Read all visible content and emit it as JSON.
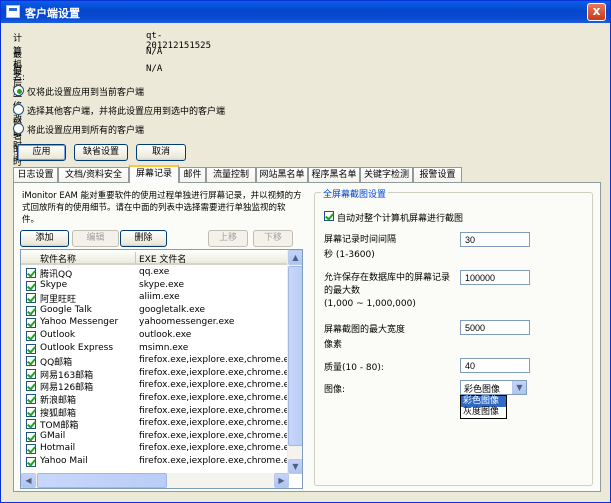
{
  "window": {
    "title": "客户端设置",
    "close_glyph": "x"
  },
  "info": {
    "computer_name_label": "计算机名:",
    "computer_name_value": "qt-201212151525",
    "last_modified_label": "最后一次修改的时间:",
    "last_modified_value": "N/A",
    "last_deployed_label": "最后一次部署的时间:",
    "last_deployed_value": "N/A"
  },
  "apply_scope": {
    "options": [
      {
        "label": "仅将此设置应用到当前客户端",
        "selected": true
      },
      {
        "label": "选择其他客户端，并将此设置应用到选中的客户端",
        "selected": false
      },
      {
        "label": "将此设置应用到所有的客户端",
        "selected": false
      }
    ]
  },
  "actions": {
    "apply": "应用",
    "default": "缺省设置",
    "cancel": "取消"
  },
  "tabs": [
    {
      "label": "日志设置",
      "active": false
    },
    {
      "label": "文档/资料安全",
      "active": false
    },
    {
      "label": "屏幕记录",
      "active": true
    },
    {
      "label": "邮件",
      "active": false
    },
    {
      "label": "流量控制",
      "active": false
    },
    {
      "label": "网站黑名单",
      "active": false
    },
    {
      "label": "程序黑名单",
      "active": false
    },
    {
      "label": "关键字检测",
      "active": false
    },
    {
      "label": "报警设置",
      "active": false
    }
  ],
  "screen_record": {
    "description": "iMonitor EAM 能对重要软件的使用过程单独进行屏幕记录，并以视频的方式回放所有的使用细节。请在中面的列表中选择需要进行单独监视的软件。",
    "buttons": {
      "add": "添加",
      "edit": "编辑",
      "delete": "删除",
      "up": "上移",
      "down": "下移"
    },
    "columns": {
      "name": "软件名称",
      "exe": "EXE 文件名"
    },
    "rows": [
      {
        "name": "腾讯QQ",
        "exe": "qq.exe",
        "checked": true
      },
      {
        "name": "Skype",
        "exe": "skype.exe",
        "checked": true
      },
      {
        "name": "阿里旺旺",
        "exe": "aliim.exe",
        "checked": true
      },
      {
        "name": "Google Talk",
        "exe": "googletalk.exe",
        "checked": true
      },
      {
        "name": "Yahoo Messenger",
        "exe": "yahoomessenger.exe",
        "checked": true
      },
      {
        "name": "Outlook",
        "exe": "outlook.exe",
        "checked": true
      },
      {
        "name": "Outlook Express",
        "exe": "msimn.exe",
        "checked": true
      },
      {
        "name": "QQ邮箱",
        "exe": "firefox.exe,iexplore.exe,chrome.exe,o...",
        "checked": true
      },
      {
        "name": "网易163邮箱",
        "exe": "firefox.exe,iexplore.exe,chrome.exe,o...",
        "checked": true
      },
      {
        "name": "网易126邮箱",
        "exe": "firefox.exe,iexplore.exe,chrome.exe,o...",
        "checked": true
      },
      {
        "name": "新浪邮箱",
        "exe": "firefox.exe,iexplore.exe,chrome.exe,o...",
        "checked": true
      },
      {
        "name": "搜狐邮箱",
        "exe": "firefox.exe,iexplore.exe,chrome.exe,o...",
        "checked": true
      },
      {
        "name": "TOM邮箱",
        "exe": "firefox.exe,iexplore.exe,chrome.exe,o...",
        "checked": true
      },
      {
        "name": "GMail",
        "exe": "firefox.exe,iexplore.exe,chrome.exe,o...",
        "checked": true
      },
      {
        "name": "Hotmail",
        "exe": "firefox.exe,iexplore.exe,chrome.exe,o...",
        "checked": true
      },
      {
        "name": "Yahoo Mail",
        "exe": "firefox.exe,iexplore.exe,chrome.exe,o...",
        "checked": true
      }
    ]
  },
  "fullscreen": {
    "group_title": "全屏幕截图设置",
    "auto_capture_label": "自动对整个计算机屏幕进行截图",
    "auto_capture_checked": true,
    "interval_label": "屏幕记录时间间隔",
    "interval_unit": "秒 (1-3600)",
    "interval_value": "30",
    "max_count_label_1": "允许保存在数据库中的屏幕记录",
    "max_count_label_2": "的最大数",
    "max_count_range": "(1,000 ~ 1,000,000)",
    "max_count_value": "100000",
    "max_width_label": "屏幕截图的最大宽度",
    "max_width_unit": "像素",
    "max_width_value": "5000",
    "quality_label": "质量(10 - 80):",
    "quality_value": "40",
    "image_label": "图像:",
    "image_selected": "彩色图像",
    "image_options": [
      "彩色图像",
      "灰度图像"
    ]
  }
}
